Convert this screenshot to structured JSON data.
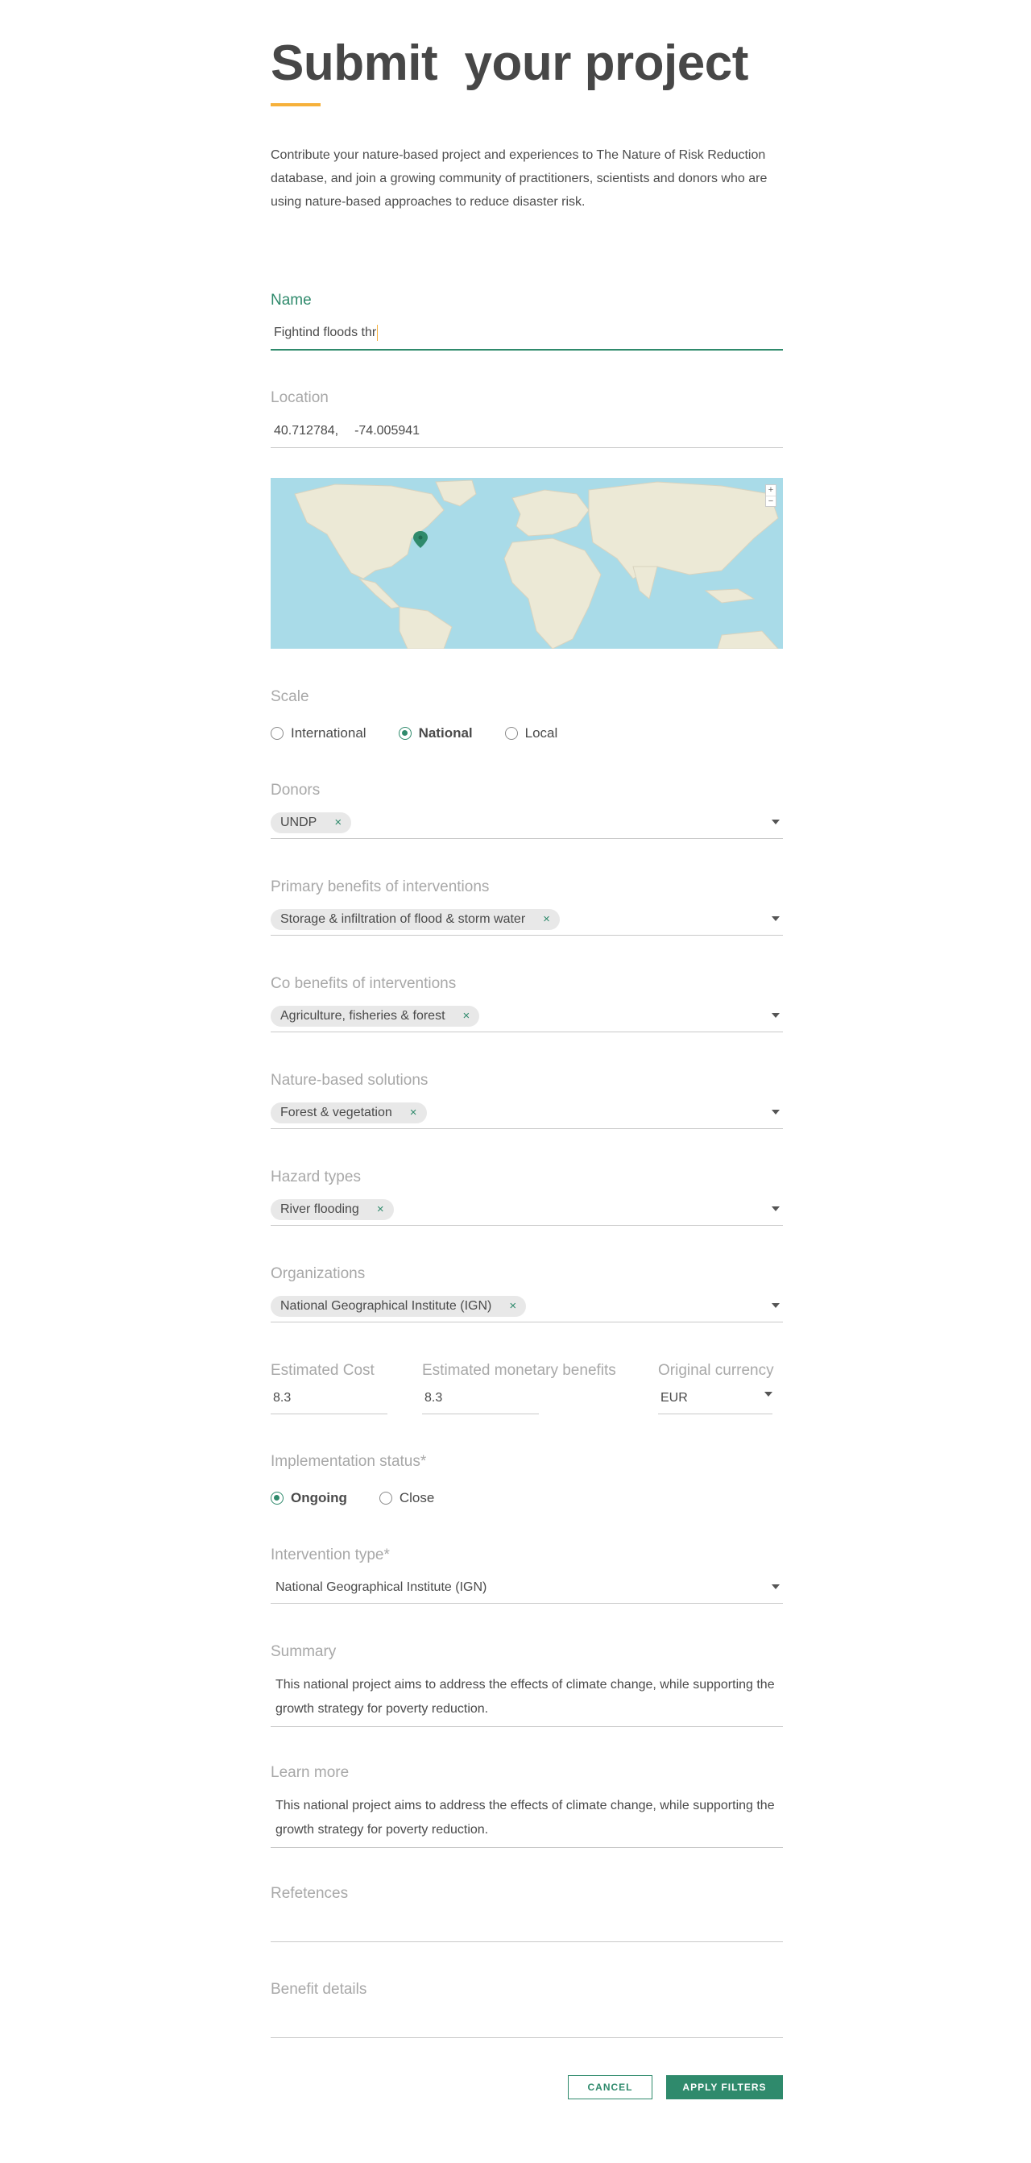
{
  "header": {
    "title": "Submit  your project",
    "intro": "Contribute your nature-based project and experiences to The Nature of Risk Reduction database, and join a growing community of practitioners, scientists and donors who are using nature-based approaches to reduce disaster risk."
  },
  "form": {
    "name": {
      "label": "Name",
      "value": "Fightind floods thr"
    },
    "location": {
      "label": "Location",
      "lat": "40.712784,",
      "lng": "-74.005941"
    },
    "map": {
      "zoom_in": "+",
      "zoom_out": "−"
    },
    "scale": {
      "label": "Scale",
      "options": [
        "International",
        "National",
        "Local"
      ],
      "selected": "National"
    },
    "donors": {
      "label": "Donors",
      "chips": [
        "UNDP"
      ]
    },
    "primary_benefits": {
      "label": "Primary benefits of interventions",
      "chips": [
        "Storage & infiltration of flood & storm water"
      ]
    },
    "co_benefits": {
      "label": "Co benefits of interventions",
      "chips": [
        "Agriculture, fisheries & forest"
      ]
    },
    "nature_based": {
      "label": "Nature-based solutions",
      "chips": [
        "Forest & vegetation"
      ]
    },
    "hazard_types": {
      "label": "Hazard types",
      "chips": [
        "River flooding"
      ]
    },
    "organizations": {
      "label": "Organizations",
      "chips": [
        "National Geographical Institute (IGN)"
      ]
    },
    "estimated_cost": {
      "label": "Estimated Cost",
      "value": "8.3"
    },
    "monetary_benefits": {
      "label": "Estimated monetary benefits",
      "value": "8.3"
    },
    "currency": {
      "label": "Original currency",
      "value": "EUR"
    },
    "implementation_status": {
      "label": "Implementation status*",
      "options": [
        "Ongoing",
        "Close"
      ],
      "selected": "Ongoing"
    },
    "intervention_type": {
      "label": "Intervention type*",
      "value": "National Geographical Institute (IGN)"
    },
    "summary": {
      "label": "Summary",
      "value": "This national project aims to address the effects of climate change, while supporting the growth strategy for poverty reduction."
    },
    "learn_more": {
      "label": "Learn more",
      "value": "This national project aims to address the effects of climate change, while supporting the growth strategy for poverty reduction."
    },
    "references": {
      "label": "Refetences",
      "value": ""
    },
    "benefit_details": {
      "label": "Benefit details",
      "value": ""
    }
  },
  "actions": {
    "cancel": "CANCEL",
    "apply": "APPLY FILTERS"
  },
  "colors": {
    "accent": "#2f8a6c",
    "highlight": "#f6b13b",
    "water": "#a9dbe8",
    "land": "#ece9d6"
  },
  "icons": {
    "chip_remove": "×",
    "map_marker": "map-marker-icon",
    "dropdown": "chevron-down-icon"
  }
}
